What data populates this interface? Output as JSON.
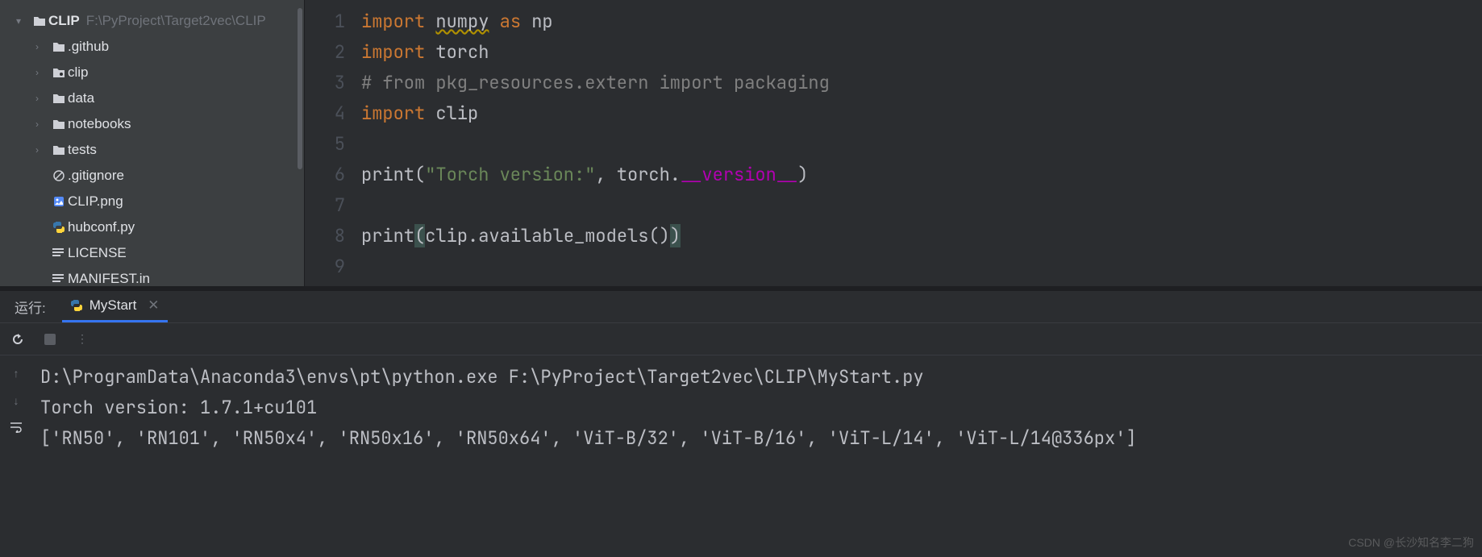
{
  "project": {
    "root": {
      "name": "CLIP",
      "path": "F:\\PyProject\\Target2vec\\CLIP"
    },
    "folders": [
      {
        "name": ".github"
      },
      {
        "name": "clip",
        "marked": true
      },
      {
        "name": "data"
      },
      {
        "name": "notebooks"
      },
      {
        "name": "tests"
      }
    ],
    "files": [
      {
        "name": ".gitignore",
        "icon": "ignore"
      },
      {
        "name": "CLIP.png",
        "icon": "image"
      },
      {
        "name": "hubconf.py",
        "icon": "python"
      },
      {
        "name": "LICENSE",
        "icon": "lines"
      },
      {
        "name": "MANIFEST.in",
        "icon": "lines"
      }
    ]
  },
  "editor": {
    "lines": [
      "1",
      "2",
      "3",
      "4",
      "5",
      "6",
      "7",
      "8",
      "9"
    ],
    "code": {
      "l1a": "import",
      "l1b": " ",
      "l1c": "numpy",
      "l1d": " ",
      "l1e": "as",
      "l1f": " np",
      "l2a": "import",
      "l2b": " torch",
      "l3": "# from pkg_resources.extern import packaging",
      "l4a": "import",
      "l4b": " clip",
      "l6a": "print(",
      "l6b": "\"Torch version:\"",
      "l6c": ", torch.",
      "l6d": "__version__",
      "l6e": ")",
      "l8a": "print",
      "l8b": "(",
      "l8c": "clip.available_models()",
      "l8d": ")"
    }
  },
  "run": {
    "label": "运行:",
    "tab": "MyStart",
    "output": {
      "cmd": "D:\\ProgramData\\Anaconda3\\envs\\pt\\python.exe F:\\PyProject\\Target2vec\\CLIP\\MyStart.py",
      "l2": "Torch version: 1.7.1+cu101",
      "l3": "['RN50', 'RN101', 'RN50x4', 'RN50x16', 'RN50x64', 'ViT-B/32', 'ViT-B/16', 'ViT-L/14', 'ViT-L/14@336px']"
    }
  },
  "watermark": "CSDN @长沙知名李二狗"
}
